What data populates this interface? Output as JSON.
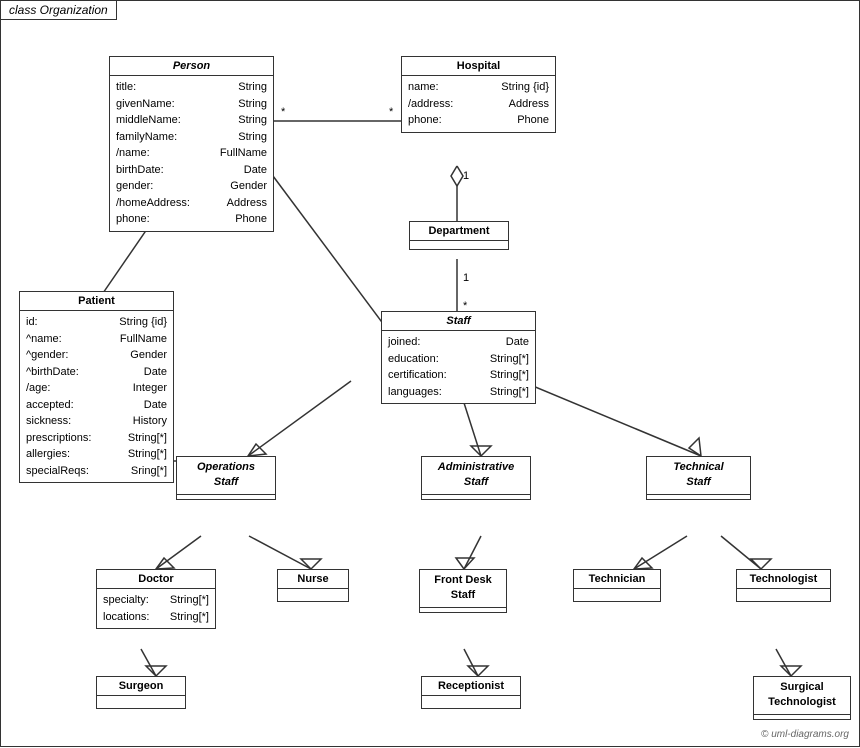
{
  "title": "class Organization",
  "copyright": "© uml-diagrams.org",
  "classes": {
    "person": {
      "name": "Person",
      "italic": true,
      "attributes": [
        {
          "name": "title:",
          "type": "String"
        },
        {
          "name": "givenName:",
          "type": "String"
        },
        {
          "name": "middleName:",
          "type": "String"
        },
        {
          "name": "familyName:",
          "type": "String"
        },
        {
          "name": "/name:",
          "type": "FullName"
        },
        {
          "name": "birthDate:",
          "type": "Date"
        },
        {
          "name": "gender:",
          "type": "Gender"
        },
        {
          "name": "/homeAddress:",
          "type": "Address"
        },
        {
          "name": "phone:",
          "type": "Phone"
        }
      ]
    },
    "hospital": {
      "name": "Hospital",
      "italic": false,
      "attributes": [
        {
          "name": "name:",
          "type": "String {id}"
        },
        {
          "name": "/address:",
          "type": "Address"
        },
        {
          "name": "phone:",
          "type": "Phone"
        }
      ]
    },
    "patient": {
      "name": "Patient",
      "italic": false,
      "attributes": [
        {
          "name": "id:",
          "type": "String {id}"
        },
        {
          "name": "^name:",
          "type": "FullName"
        },
        {
          "name": "^gender:",
          "type": "Gender"
        },
        {
          "name": "^birthDate:",
          "type": "Date"
        },
        {
          "name": "/age:",
          "type": "Integer"
        },
        {
          "name": "accepted:",
          "type": "Date"
        },
        {
          "name": "sickness:",
          "type": "History"
        },
        {
          "name": "prescriptions:",
          "type": "String[*]"
        },
        {
          "name": "allergies:",
          "type": "String[*]"
        },
        {
          "name": "specialReqs:",
          "type": "Sring[*]"
        }
      ]
    },
    "department": {
      "name": "Department",
      "italic": false,
      "attributes": []
    },
    "staff": {
      "name": "Staff",
      "italic": true,
      "attributes": [
        {
          "name": "joined:",
          "type": "Date"
        },
        {
          "name": "education:",
          "type": "String[*]"
        },
        {
          "name": "certification:",
          "type": "String[*]"
        },
        {
          "name": "languages:",
          "type": "String[*]"
        }
      ]
    },
    "operations_staff": {
      "name": "Operations\nStaff",
      "italic": true,
      "attributes": []
    },
    "administrative_staff": {
      "name": "Administrative\nStaff",
      "italic": true,
      "attributes": []
    },
    "technical_staff": {
      "name": "Technical\nStaff",
      "italic": true,
      "attributes": []
    },
    "doctor": {
      "name": "Doctor",
      "italic": false,
      "attributes": [
        {
          "name": "specialty:",
          "type": "String[*]"
        },
        {
          "name": "locations:",
          "type": "String[*]"
        }
      ]
    },
    "nurse": {
      "name": "Nurse",
      "italic": false,
      "attributes": []
    },
    "front_desk_staff": {
      "name": "Front Desk\nStaff",
      "italic": false,
      "attributes": []
    },
    "technician": {
      "name": "Technician",
      "italic": false,
      "attributes": []
    },
    "technologist": {
      "name": "Technologist",
      "italic": false,
      "attributes": []
    },
    "surgeon": {
      "name": "Surgeon",
      "italic": false,
      "attributes": []
    },
    "receptionist": {
      "name": "Receptionist",
      "italic": false,
      "attributes": []
    },
    "surgical_technologist": {
      "name": "Surgical\nTechnologist",
      "italic": false,
      "attributes": []
    }
  }
}
